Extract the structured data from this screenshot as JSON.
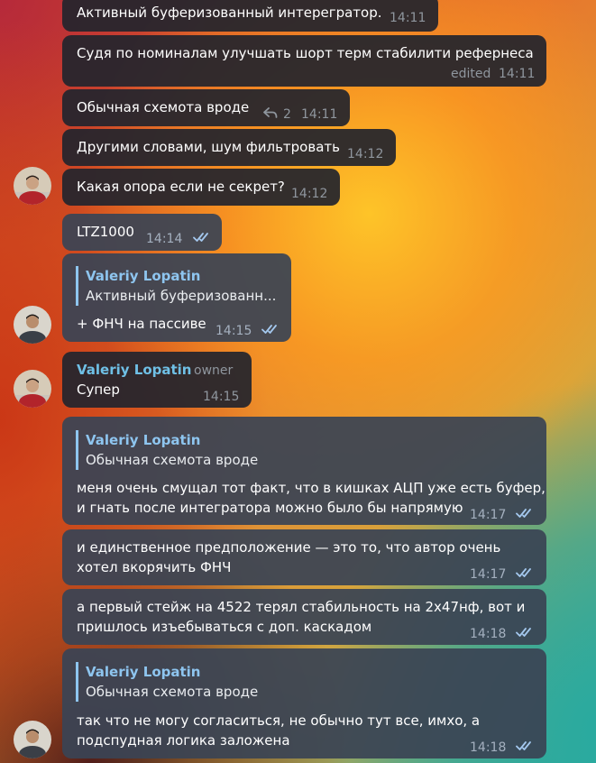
{
  "messages": [
    {
      "text": "Активный буферизованный интерегратор.",
      "time": "14:11"
    },
    {
      "text": "Судя по номиналам улучшать шорт терм стабилити рефернеса",
      "edited": "edited",
      "time": "14:11"
    },
    {
      "text": "Обычная схемота вроде",
      "replies": "2",
      "time": "14:11"
    },
    {
      "text": "Другими словами, шум фильтровать",
      "time": "14:12"
    },
    {
      "text": "Какая опора если не секрет?",
      "time": "14:12"
    },
    {
      "text": "LTZ1000",
      "time": "14:14"
    },
    {
      "quote_name": "Valeriy Lopatin",
      "quote_text": "Активный буферизованн...",
      "text": "+ ФНЧ на пассиве",
      "time": "14:15"
    },
    {
      "sender": "Valeriy Lopatin",
      "role": "owner",
      "text": "Супер",
      "time": "14:15"
    },
    {
      "quote_name": "Valeriy Lopatin",
      "quote_text": "Обычная схемота вроде",
      "line1": "меня очень смущал тот факт, что в кишках АЦП уже есть буфер,",
      "line2": "и гнать после интегратора можно было бы напрямую",
      "time": "14:17"
    },
    {
      "line1": "и единственное предположение — это то, что автор очень",
      "line2": "хотел вкорячить ФНЧ",
      "time": "14:17"
    },
    {
      "line1": "а первый стейж на 4522 терял стабильность на 2х47нф, вот и",
      "line2": "пришлось изъебываться с доп. каскадом",
      "time": "14:18"
    },
    {
      "quote_name": "Valeriy Lopatin",
      "quote_text": "Обычная схемота вроде",
      "line1": "так что не могу согласиться, не обычно тут все, имхо, а",
      "line2": "подспудная логика заложена",
      "time": "14:18"
    }
  ],
  "icons": {
    "read": "double-check-icon",
    "reply": "reply-arrow-icon"
  },
  "colors": {
    "incoming_bubble": "#23252d",
    "outgoing_bubble": "#3a4454",
    "accent": "#8ec5ef",
    "sender_name": "#6fc0e6"
  }
}
